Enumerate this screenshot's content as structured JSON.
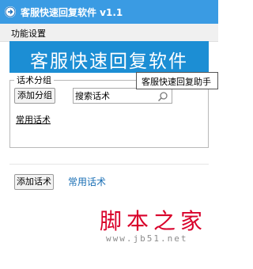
{
  "window": {
    "title": "客服快速回复软件 v1.1"
  },
  "menu": {
    "items": [
      "功能设置"
    ]
  },
  "banner": {
    "text": "客服快速回复软件"
  },
  "tooltip": {
    "text": "客服快速回复助手"
  },
  "group_section": {
    "legend": "话术分组",
    "add_group_label": "添加分组",
    "search": {
      "value": "搜索话术",
      "placeholder": "搜索话术"
    },
    "groups": [
      "常用话术"
    ]
  },
  "bottom": {
    "add_phrase_label": "添加话术",
    "current_group": "常用话术"
  },
  "watermark": {
    "text": "脚本之家",
    "url": "www.jb51.net"
  },
  "colors": {
    "titlebar": "#3a9be3",
    "banner": "#1c8ed4",
    "link": "#1a6fb5",
    "watermark": "#d9002a"
  }
}
